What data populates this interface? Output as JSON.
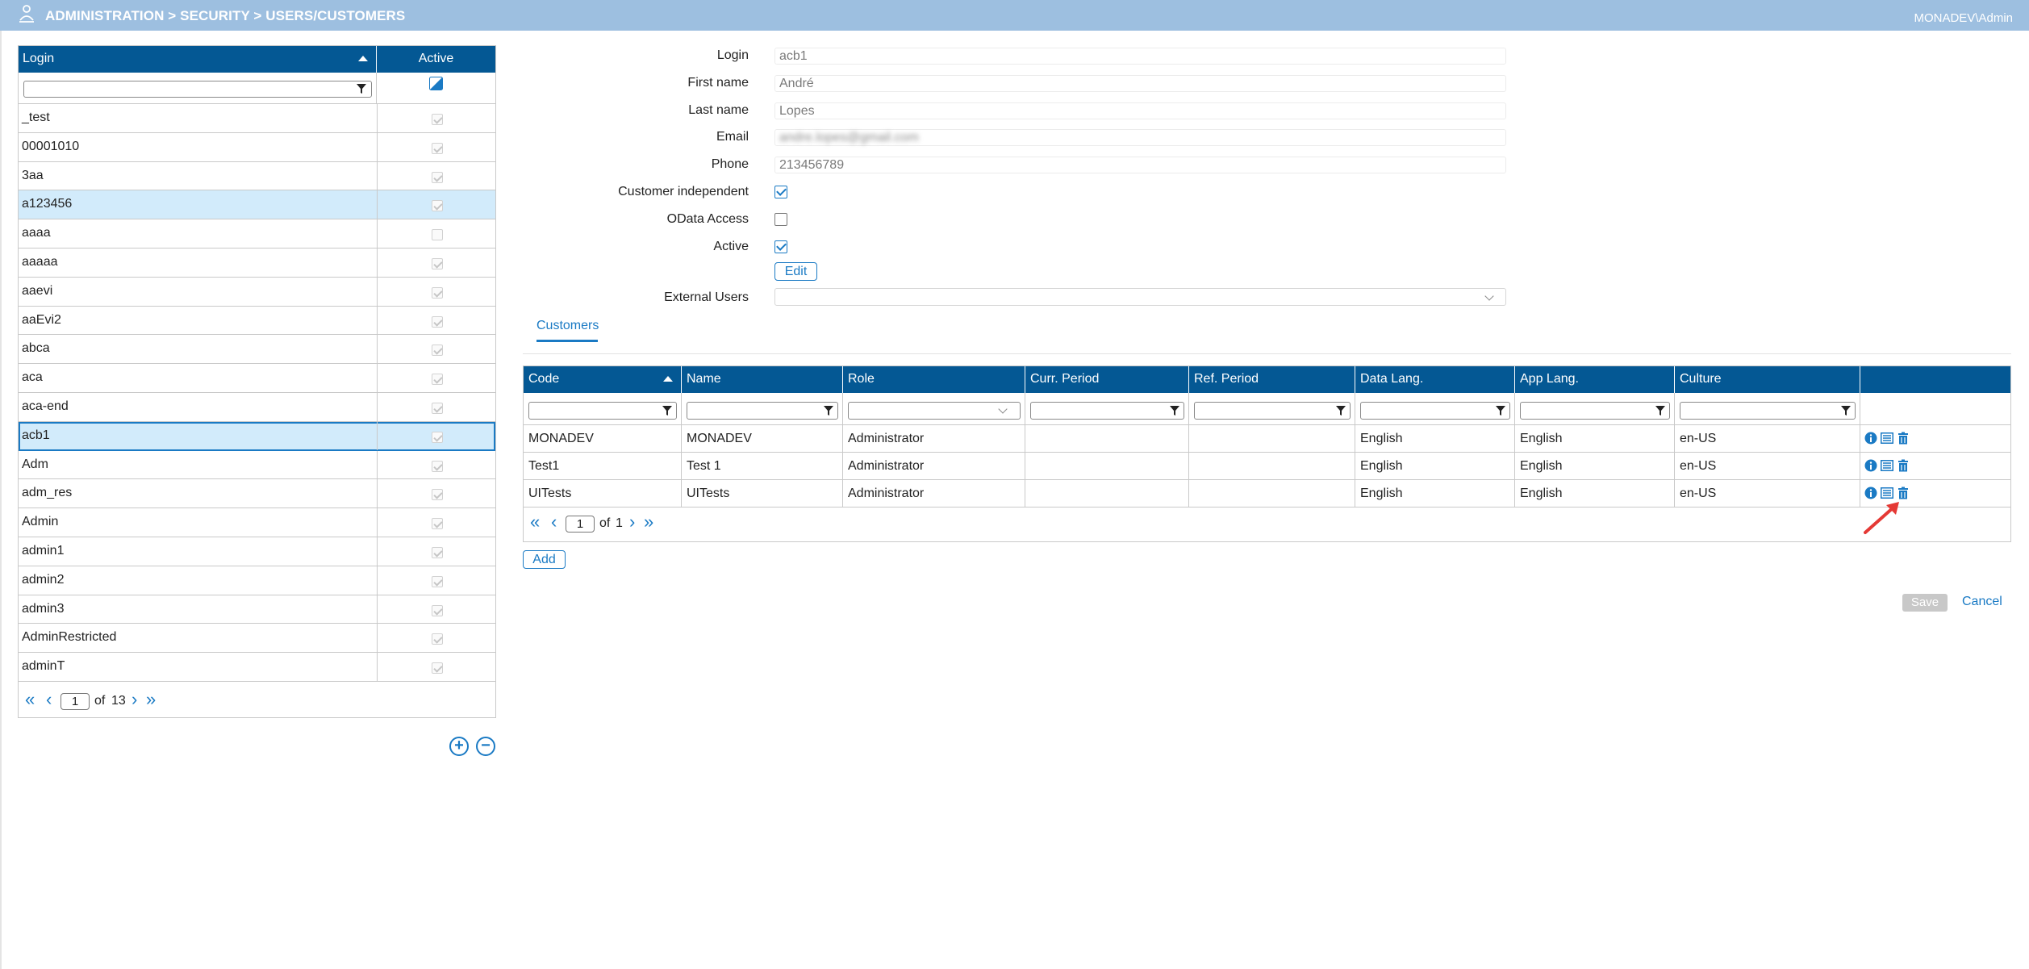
{
  "header": {
    "breadcrumb": "ADMINISTRATION > SECURITY > USERS/CUSTOMERS",
    "user": "MONADEV\\Admin",
    "bg_color": "#9dbfe0"
  },
  "users_grid": {
    "col_login": "Login",
    "col_active": "Active",
    "filter_value": "",
    "rows": [
      {
        "login": "_test",
        "active": true
      },
      {
        "login": "00001010",
        "active": true
      },
      {
        "login": "3aa",
        "active": true
      },
      {
        "login": "a123456",
        "active": true
      },
      {
        "login": "aaaa",
        "active": false
      },
      {
        "login": "aaaaa",
        "active": true
      },
      {
        "login": "aaevi",
        "active": true
      },
      {
        "login": "aaEvi2",
        "active": true
      },
      {
        "login": "abca",
        "active": true
      },
      {
        "login": "aca",
        "active": true
      },
      {
        "login": "aca-end",
        "active": true
      },
      {
        "login": "acb1",
        "active": true
      },
      {
        "login": "Adm",
        "active": true
      },
      {
        "login": "adm_res",
        "active": true
      },
      {
        "login": "Admin",
        "active": true
      },
      {
        "login": "admin1",
        "active": true
      },
      {
        "login": "admin2",
        "active": true
      },
      {
        "login": "admin3",
        "active": true
      },
      {
        "login": "AdminRestricted",
        "active": true
      },
      {
        "login": "adminT",
        "active": true
      }
    ],
    "pager": {
      "page": "1",
      "of_label": "of",
      "total": "13"
    }
  },
  "form": {
    "login_label": "Login",
    "login_value": "acb1",
    "first_name_label": "First name",
    "first_name_value": "André",
    "last_name_label": "Last name",
    "last_name_value": "Lopes",
    "email_label": "Email",
    "email_value": "andre.lopes@gmail.com",
    "phone_label": "Phone",
    "phone_value": "213456789",
    "customer_independent_label": "Customer independent",
    "customer_independent": true,
    "odata_label": "OData Access",
    "odata": false,
    "active_label": "Active",
    "active": true,
    "edit_label": "Edit",
    "external_users_label": "External Users",
    "external_users_value": ""
  },
  "tabs": [
    {
      "label": "Customers",
      "active": true
    }
  ],
  "customers_grid": {
    "columns": [
      "Code",
      "Name",
      "Role",
      "Curr. Period",
      "Ref. Period",
      "Data Lang.",
      "App Lang.",
      "Culture"
    ],
    "rows": [
      {
        "code": "MONADEV",
        "name": "MONADEV",
        "role": "Administrator",
        "curr": "",
        "ref": "",
        "data_lang": "English",
        "app_lang": "English",
        "culture": "en-US"
      },
      {
        "code": "Test1",
        "name": "Test 1",
        "role": "Administrator",
        "curr": "",
        "ref": "",
        "data_lang": "English",
        "app_lang": "English",
        "culture": "en-US"
      },
      {
        "code": "UITests",
        "name": "UITests",
        "role": "Administrator",
        "curr": "",
        "ref": "",
        "data_lang": "English",
        "app_lang": "English",
        "culture": "en-US"
      }
    ],
    "pager": {
      "page": "1",
      "of_label": "of",
      "total": "1"
    }
  },
  "actions": {
    "add_label": "Add",
    "save_label": "Save",
    "cancel_label": "Cancel"
  },
  "colors": {
    "grid_header": "#045894",
    "accent": "#1a7ac4",
    "row_highlight": "#d2ebfb",
    "annotation_arrow": "#e53935"
  }
}
